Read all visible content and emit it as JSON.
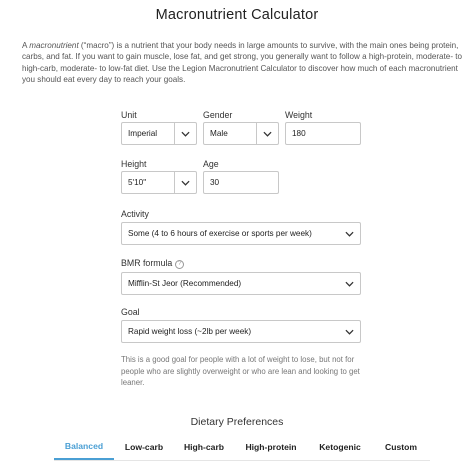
{
  "page": {
    "title": "Macronutrient Calculator",
    "intro_pre": "A ",
    "intro_em": "macronutrient",
    "intro_post": " (“macro”) is a nutrient that your body needs in large amounts to survive, with the main ones being protein, carbs, and fat. If you want to gain muscle, lose fat, and get strong, you generally want to follow a high-protein, moderate- to high-carb, moderate- to low-fat diet. Use the Legion Macronutrient Calculator to discover how much of each macronutrient you should eat every day to reach your goals."
  },
  "form": {
    "unit": {
      "label": "Unit",
      "value": "Imperial"
    },
    "gender": {
      "label": "Gender",
      "value": "Male"
    },
    "weight": {
      "label": "Weight",
      "value": "180"
    },
    "height": {
      "label": "Height",
      "value": "5'10\""
    },
    "age": {
      "label": "Age",
      "value": "30"
    },
    "activity": {
      "label": "Activity",
      "value": "Some (4 to 6 hours of exercise or sports per week)"
    },
    "bmr": {
      "label": "BMR formula",
      "value": "Mifflin-St Jeor (Recommended)",
      "help_icon": "?"
    },
    "goal": {
      "label": "Goal",
      "value": "Rapid weight loss (~2lb per week)"
    },
    "goal_note": "This is a good goal for people with a lot of weight to lose, but not for people who are slightly overweight or who are lean and looking to get leaner."
  },
  "dietary": {
    "title": "Dietary Preferences",
    "tabs": [
      "Balanced",
      "Low-carb",
      "High-carb",
      "High-protein",
      "Ketogenic",
      "Custom"
    ],
    "active": "Balanced",
    "accent_color": "#4a9fd4"
  }
}
